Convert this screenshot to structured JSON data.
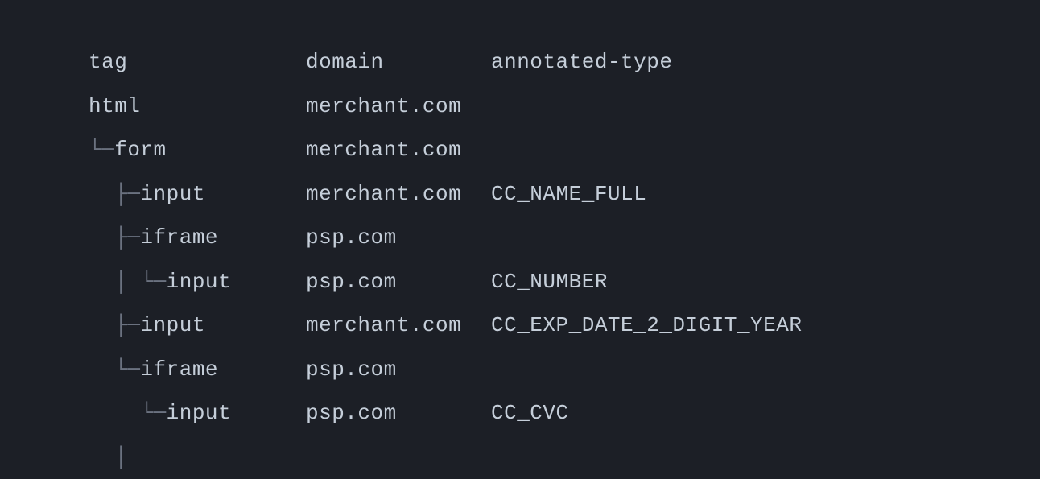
{
  "headers": {
    "tag": "tag",
    "domain": "domain",
    "annotated_type": "annotated-type"
  },
  "rows": [
    {
      "prefix": "",
      "tag": "html",
      "domain": "merchant.com",
      "type": ""
    },
    {
      "prefix": "└─",
      "tag": "form",
      "domain": "merchant.com",
      "type": ""
    },
    {
      "prefix": "  ├─",
      "tag": "input",
      "domain": "merchant.com",
      "type": "CC_NAME_FULL"
    },
    {
      "prefix": "  ├─",
      "tag": "iframe",
      "domain": "psp.com",
      "type": ""
    },
    {
      "prefix": "  │ └─",
      "tag": "input",
      "domain": "psp.com",
      "type": "CC_NUMBER"
    },
    {
      "prefix": "  ├─",
      "tag": "input",
      "domain": "merchant.com",
      "type": "CC_EXP_DATE_2_DIGIT_YEAR"
    },
    {
      "prefix": "  └─",
      "tag": "iframe",
      "domain": "psp.com",
      "type": ""
    },
    {
      "prefix": "    └─",
      "tag": "input",
      "domain": "psp.com",
      "type": "CC_CVC"
    },
    {
      "prefix": "  │",
      "tag": "",
      "domain": "",
      "type": ""
    }
  ]
}
